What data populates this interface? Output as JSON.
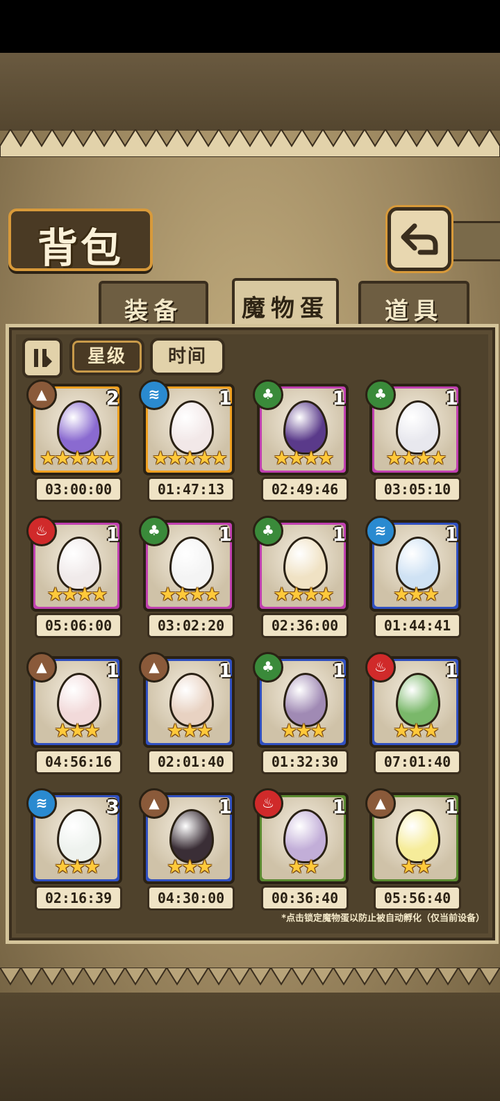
{
  "title": "背包",
  "tabs": [
    "装备",
    "魔物蛋",
    "道具"
  ],
  "active_tab": "魔物蛋",
  "sort": {
    "label_star": "星级",
    "label_time": "时间",
    "active": "星级"
  },
  "footnote": "*点击锁定魔物蛋以防止被自动孵化（仅当前设备）",
  "colors": {
    "frame_gold": "#f0a020",
    "frame_purple": "#c040b0",
    "frame_blue": "#3050c0",
    "frame_green": "#5a8a30",
    "element_earth": "#8a5a3a",
    "element_water": "#2a8ad0",
    "element_nature": "#3a8a3a",
    "element_fire": "#d02a2a"
  },
  "eggs": [
    {
      "count": "2",
      "stars": 5,
      "time": "03:00:00",
      "rarity": "gold",
      "element": "earth",
      "egg_color": "#8a6ad0"
    },
    {
      "count": "1",
      "stars": 5,
      "time": "01:47:13",
      "rarity": "gold",
      "element": "water",
      "egg_color": "#f2e8e8"
    },
    {
      "count": "1",
      "stars": 4,
      "time": "02:49:46",
      "rarity": "purple",
      "element": "nature",
      "egg_color": "#5a3a8a"
    },
    {
      "count": "1",
      "stars": 4,
      "time": "03:05:10",
      "rarity": "purple",
      "element": "nature",
      "egg_color": "#e8e8ee"
    },
    {
      "count": "1",
      "stars": 4,
      "time": "05:06:00",
      "rarity": "purple",
      "element": "fire",
      "egg_color": "#f0eaea"
    },
    {
      "count": "1",
      "stars": 4,
      "time": "03:02:20",
      "rarity": "purple",
      "element": "nature",
      "egg_color": "#f4f4f4"
    },
    {
      "count": "1",
      "stars": 4,
      "time": "02:36:00",
      "rarity": "purple",
      "element": "nature",
      "egg_color": "#f0e2c4"
    },
    {
      "count": "1",
      "stars": 3,
      "time": "01:44:41",
      "rarity": "blue",
      "element": "water",
      "egg_color": "#cfe2f4"
    },
    {
      "count": "1",
      "stars": 3,
      "time": "04:56:16",
      "rarity": "blue",
      "element": "earth",
      "egg_color": "#f2dada"
    },
    {
      "count": "1",
      "stars": 3,
      "time": "02:01:40",
      "rarity": "blue",
      "element": "earth",
      "egg_color": "#e8d2c2"
    },
    {
      "count": "1",
      "stars": 3,
      "time": "01:32:30",
      "rarity": "blue",
      "element": "nature",
      "egg_color": "#a08ab4"
    },
    {
      "count": "1",
      "stars": 3,
      "time": "07:01:40",
      "rarity": "blue",
      "element": "fire",
      "egg_color": "#7ab86a"
    },
    {
      "count": "3",
      "stars": 3,
      "time": "02:16:39",
      "rarity": "blue",
      "element": "water",
      "egg_color": "#eef2ee"
    },
    {
      "count": "1",
      "stars": 3,
      "time": "04:30:00",
      "rarity": "blue",
      "element": "earth",
      "egg_color": "#3a2e36"
    },
    {
      "count": "1",
      "stars": 2,
      "time": "00:36:40",
      "rarity": "green",
      "element": "fire",
      "egg_color": "#c2aed8"
    },
    {
      "count": "1",
      "stars": 2,
      "time": "05:56:40",
      "rarity": "green",
      "element": "earth",
      "egg_color": "#f6ec9a"
    }
  ]
}
